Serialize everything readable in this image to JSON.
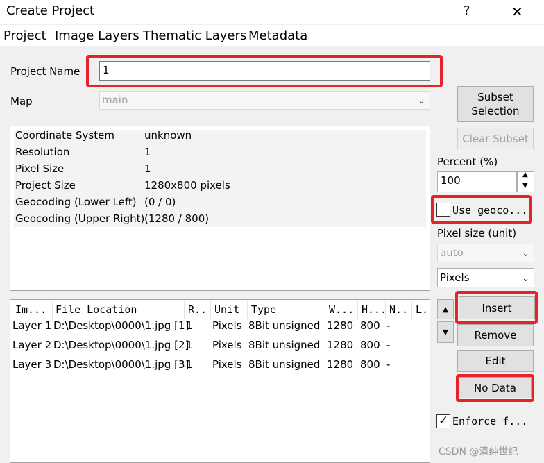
{
  "window": {
    "title": "Create Project",
    "help_icon": "?",
    "close_icon": "✕"
  },
  "menu": [
    "Project",
    "Image Layers",
    "Thematic Layers",
    "Metadata"
  ],
  "project_name": {
    "label": "Project Name",
    "value": "1"
  },
  "map": {
    "label": "Map",
    "value": "main"
  },
  "properties": [
    {
      "key": "Coordinate System",
      "value": "unknown"
    },
    {
      "key": "Resolution",
      "value": "1"
    },
    {
      "key": "Pixel Size",
      "value": "1"
    },
    {
      "key": "Project Size",
      "value": "1280x800 pixels"
    },
    {
      "key": "Geocoding (Lower Left)",
      "value": "(0 / 0)"
    },
    {
      "key": "Geocoding (Upper Right)",
      "value": "(1280 / 800)"
    }
  ],
  "layers_table": {
    "columns": [
      "Im...",
      "File Location",
      "R..",
      "Unit",
      "Type",
      "W...",
      "H...",
      "N..",
      "L."
    ],
    "rows": [
      [
        "Layer 1",
        "D:\\Desktop\\0000\\1.jpg [1]",
        "1",
        "Pixels",
        "8Bit unsigned",
        "1280",
        "800",
        "-"
      ],
      [
        "Layer 2",
        "D:\\Desktop\\0000\\1.jpg [2]",
        "1",
        "Pixels",
        "8Bit unsigned",
        "1280",
        "800",
        "-"
      ],
      [
        "Layer 3",
        "D:\\Desktop\\0000\\1.jpg [3]",
        "1",
        "Pixels",
        "8Bit unsigned",
        "1280",
        "800",
        "-"
      ]
    ]
  },
  "right_panel": {
    "subset_selection": "Subset Selection",
    "clear_subset": "Clear Subset",
    "percent_label": "Percent (%)",
    "percent_value": "100",
    "use_geocoding": "Use geoco...",
    "pixel_size_label": "Pixel size (unit)",
    "pixel_size_value": "auto",
    "unit_value": "Pixels",
    "insert": "Insert",
    "remove": "Remove",
    "edit": "Edit",
    "no_data": "No Data",
    "enforce": "Enforce f...",
    "enforce_checked": true,
    "use_geocoding_checked": false
  },
  "watermark": "CSDN @清纯世纪",
  "colors": {
    "highlight": "#e8222a"
  }
}
